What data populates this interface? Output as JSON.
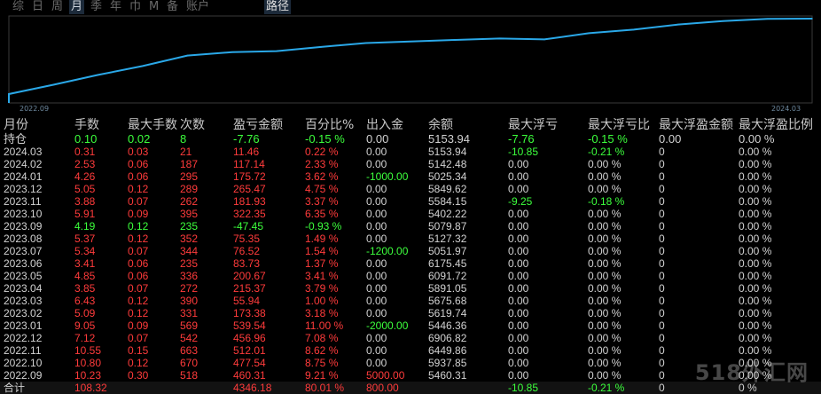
{
  "tabs": [
    {
      "label": "综"
    },
    {
      "label": "日"
    },
    {
      "label": "周"
    },
    {
      "label": "月"
    },
    {
      "label": "季"
    },
    {
      "label": "年"
    },
    {
      "label": "巾"
    },
    {
      "label": "M"
    },
    {
      "label": "备"
    },
    {
      "label": "账户"
    }
  ],
  "route_label": "路径",
  "chart_data": {
    "type": "line",
    "x_start_label": "2022.09",
    "x_end_label": "2024.03",
    "x": [
      "2022.09",
      "2022.10",
      "2022.11",
      "2022.12",
      "2023.01",
      "2023.02",
      "2023.03",
      "2023.04",
      "2023.05",
      "2023.06",
      "2023.07",
      "2023.08",
      "2023.09",
      "2023.10",
      "2023.11",
      "2023.12",
      "2024.01",
      "2024.02",
      "2024.03"
    ],
    "series": [
      {
        "values": [
          460.31,
          938.15,
          1450.16,
          1906.12,
          2445.66,
          2619.04,
          2674.98,
          2890.35,
          3091.02,
          3174.75,
          3251.27,
          3326.62,
          3279.17,
          3601.52,
          3783.45,
          4048.92,
          4224.64,
          4341.78,
          4353.24
        ]
      }
    ],
    "line_color": "#2aa8e8"
  },
  "table": {
    "headers": [
      "月份",
      "手数",
      "最大手数",
      "次数",
      "盈亏金额",
      "百分比%",
      "出入金",
      "余额",
      "最大浮亏",
      "最大浮亏比",
      "最大浮盈金额",
      "最大浮盈比例"
    ],
    "holding": {
      "cells": [
        "持仓",
        "0.10",
        "0.02",
        "8",
        "-7.76",
        "-0.15 %",
        "0.00",
        "5153.94",
        "-7.76",
        "-0.15 %",
        "0.00",
        "0.00 %"
      ]
    },
    "rows": [
      {
        "cells": [
          "2024.03",
          "0.31",
          "0.03",
          "21",
          "11.46",
          "0.22 %",
          "0.00",
          "5153.94",
          "-10.85",
          "-0.21 %",
          "0",
          "0.00 %"
        ]
      },
      {
        "cells": [
          "2024.02",
          "2.53",
          "0.06",
          "187",
          "117.14",
          "2.33 %",
          "0.00",
          "5142.48",
          "0.00",
          "0.00 %",
          "0",
          "0.00 %"
        ]
      },
      {
        "cells": [
          "2024.01",
          "4.26",
          "0.06",
          "295",
          "175.72",
          "3.62 %",
          "-1000.00",
          "5025.34",
          "0.00",
          "0.00 %",
          "0",
          "0.00 %"
        ]
      },
      {
        "cells": [
          "2023.12",
          "5.05",
          "0.12",
          "289",
          "265.47",
          "4.75 %",
          "0.00",
          "5849.62",
          "0.00",
          "0.00 %",
          "0",
          "0.00 %"
        ]
      },
      {
        "cells": [
          "2023.11",
          "3.88",
          "0.07",
          "262",
          "181.93",
          "3.37 %",
          "0.00",
          "5584.15",
          "-9.25",
          "-0.18 %",
          "0",
          "0.00 %"
        ]
      },
      {
        "cells": [
          "2023.10",
          "5.91",
          "0.09",
          "395",
          "322.35",
          "6.35 %",
          "0.00",
          "5402.22",
          "0.00",
          "0.00 %",
          "0",
          "0.00 %"
        ]
      },
      {
        "cells": [
          "2023.09",
          "4.19",
          "0.12",
          "235",
          "-47.45",
          "-0.93 %",
          "0.00",
          "5079.87",
          "0.00",
          "0.00 %",
          "0",
          "0.00 %"
        ]
      },
      {
        "cells": [
          "2023.08",
          "5.37",
          "0.12",
          "352",
          "75.35",
          "1.49 %",
          "0.00",
          "5127.32",
          "0.00",
          "0.00 %",
          "0",
          "0.00 %"
        ]
      },
      {
        "cells": [
          "2023.07",
          "5.34",
          "0.07",
          "344",
          "76.52",
          "1.54 %",
          "-1200.00",
          "5051.97",
          "0.00",
          "0.00 %",
          "0",
          "0.00 %"
        ]
      },
      {
        "cells": [
          "2023.06",
          "3.41",
          "0.06",
          "235",
          "83.73",
          "1.37 %",
          "0.00",
          "6175.45",
          "0.00",
          "0.00 %",
          "0",
          "0.00 %"
        ]
      },
      {
        "cells": [
          "2023.05",
          "4.85",
          "0.06",
          "336",
          "200.67",
          "3.41 %",
          "0.00",
          "6091.72",
          "0.00",
          "0.00 %",
          "0",
          "0.00 %"
        ]
      },
      {
        "cells": [
          "2023.04",
          "3.85",
          "0.07",
          "272",
          "215.37",
          "3.79 %",
          "0.00",
          "5891.05",
          "0.00",
          "0.00 %",
          "0",
          "0.00 %"
        ]
      },
      {
        "cells": [
          "2023.03",
          "6.43",
          "0.12",
          "390",
          "55.94",
          "1.00 %",
          "0.00",
          "5675.68",
          "0.00",
          "0.00 %",
          "0",
          "0.00 %"
        ]
      },
      {
        "cells": [
          "2023.02",
          "5.09",
          "0.12",
          "331",
          "173.38",
          "3.18 %",
          "0.00",
          "5619.74",
          "0.00",
          "0.00 %",
          "0",
          "0.00 %"
        ]
      },
      {
        "cells": [
          "2023.01",
          "9.05",
          "0.09",
          "569",
          "539.54",
          "11.00 %",
          "-2000.00",
          "5446.36",
          "0.00",
          "0.00 %",
          "0",
          "0.00 %"
        ]
      },
      {
        "cells": [
          "2022.12",
          "7.12",
          "0.07",
          "542",
          "456.96",
          "7.08 %",
          "0.00",
          "6906.82",
          "0.00",
          "0.00 %",
          "0",
          "0.00 %"
        ]
      },
      {
        "cells": [
          "2022.11",
          "10.55",
          "0.15",
          "663",
          "512.01",
          "8.62 %",
          "0.00",
          "6449.86",
          "0.00",
          "0.00 %",
          "0",
          "0.00 %"
        ]
      },
      {
        "cells": [
          "2022.10",
          "10.80",
          "0.12",
          "670",
          "477.54",
          "8.75 %",
          "0.00",
          "5937.85",
          "0.00",
          "0.00 %",
          "0",
          "0.00 %"
        ]
      },
      {
        "cells": [
          "2022.09",
          "10.23",
          "0.30",
          "518",
          "460.31",
          "9.21 %",
          "5000.00",
          "5460.31",
          "0.00",
          "0.00 %",
          "0",
          "0.00 %"
        ]
      }
    ],
    "total": {
      "cells": [
        "合计",
        "108.32",
        "",
        "",
        "4346.18",
        "80.01 %",
        "800.00",
        "",
        "-10.85",
        "-0.21 %",
        "0",
        "0 %"
      ]
    }
  },
  "watermark": "518外汇网",
  "colors": {
    "up": "#ff3b3b",
    "down": "#3cff3c",
    "neutral": "#d2d2d2",
    "line": "#2aa8e8"
  }
}
